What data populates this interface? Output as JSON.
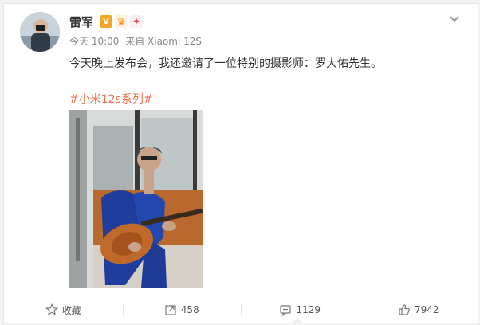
{
  "post": {
    "author": "雷军",
    "badges": [
      "verified-v-icon",
      "vip-crown-icon",
      "pinned-icon"
    ],
    "time": "今天 10:00",
    "source": "来自 Xiaomi 12S",
    "text": "今天晚上发布会，我还邀请了一位特别的摄影师：罗大佑先生。",
    "hashtag": "#小米12s系列#"
  },
  "actions": {
    "favorite_label": "收藏",
    "repost_count": "458",
    "comment_count": "1129",
    "like_count": "7942"
  },
  "colors": {
    "hashtag": "#eb7350",
    "verified": "#f5a623",
    "background": "#f2f2f2"
  }
}
